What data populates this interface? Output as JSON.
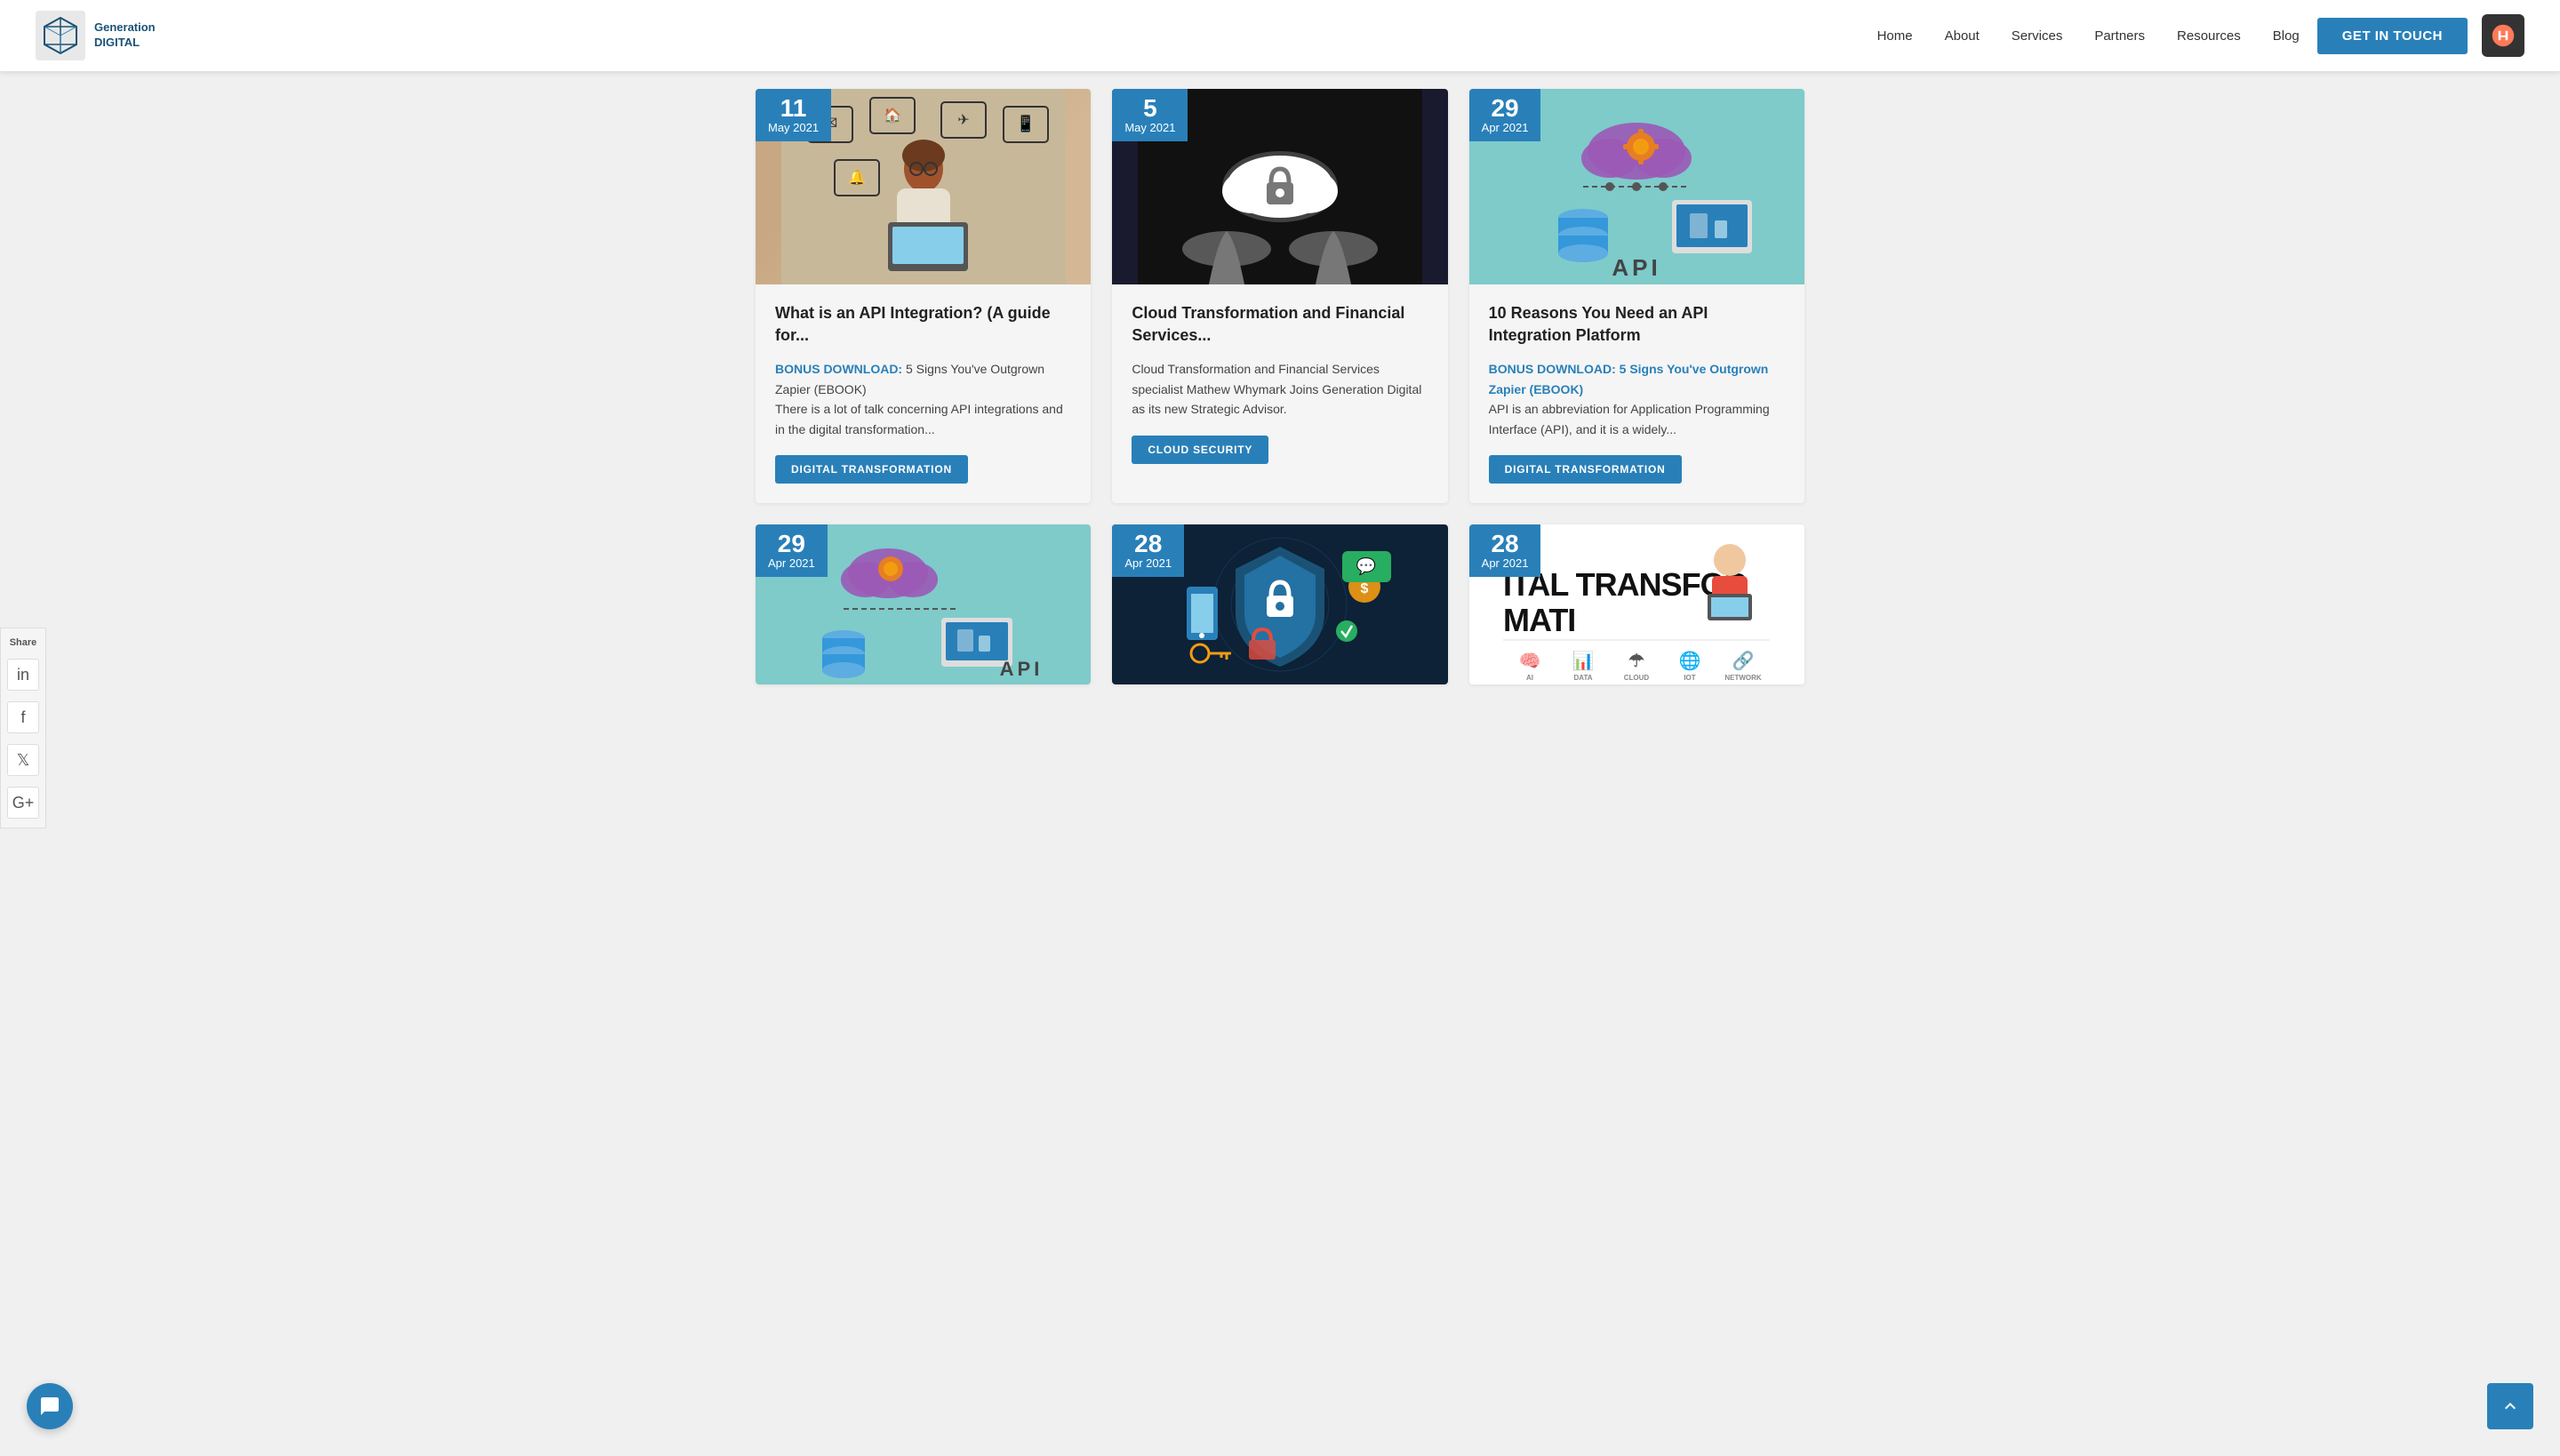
{
  "header": {
    "logo_line1": "Generation",
    "logo_line2": "DIGITAL",
    "nav": [
      {
        "label": "Home",
        "href": "#"
      },
      {
        "label": "About",
        "href": "#"
      },
      {
        "label": "Services",
        "href": "#"
      },
      {
        "label": "Partners",
        "href": "#"
      },
      {
        "label": "Resources",
        "href": "#"
      },
      {
        "label": "Blog",
        "href": "#"
      }
    ],
    "cta_label": "GET IN TOUCH"
  },
  "share_bar": {
    "label": "Share"
  },
  "cards_row1": [
    {
      "date_day": "11",
      "date_month_year": "May 2021",
      "title": "What is an API Integration? (A guide for...",
      "bonus": "BONUS DOWNLOAD:",
      "bonus_rest": " 5 Signs You've Outgrown Zapier (EBOOK)",
      "text": "There is a lot of talk concerning API integrations and in the digital transformation...",
      "tag": "DIGITAL TRANSFORMATION"
    },
    {
      "date_day": "5",
      "date_month_year": "May 2021",
      "title": "Cloud Transformation and Financial Services...",
      "bonus": "",
      "bonus_rest": "",
      "text": "Cloud Transformation and Financial Services specialist Mathew Whymark Joins Generation Digital as its new Strategic Advisor.",
      "tag": "CLOUD SECURITY"
    },
    {
      "date_day": "29",
      "date_month_year": "Apr 2021",
      "title": "10 Reasons You Need an API Integration Platform",
      "bonus": "BONUS DOWNLOAD: 5 Signs You've Outgrown Zapier (EBOOK)",
      "bonus_rest": "",
      "text": "API is an abbreviation for Application Programming Interface (API), and it is a widely...",
      "tag": "DIGITAL TRANSFORMATION"
    }
  ],
  "cards_row2": [
    {
      "date_day": "29",
      "date_month_year": "Apr 2021"
    },
    {
      "date_day": "28",
      "date_month_year": "Apr 2021"
    },
    {
      "date_day": "28",
      "date_month_year": "Apr 2021"
    }
  ]
}
